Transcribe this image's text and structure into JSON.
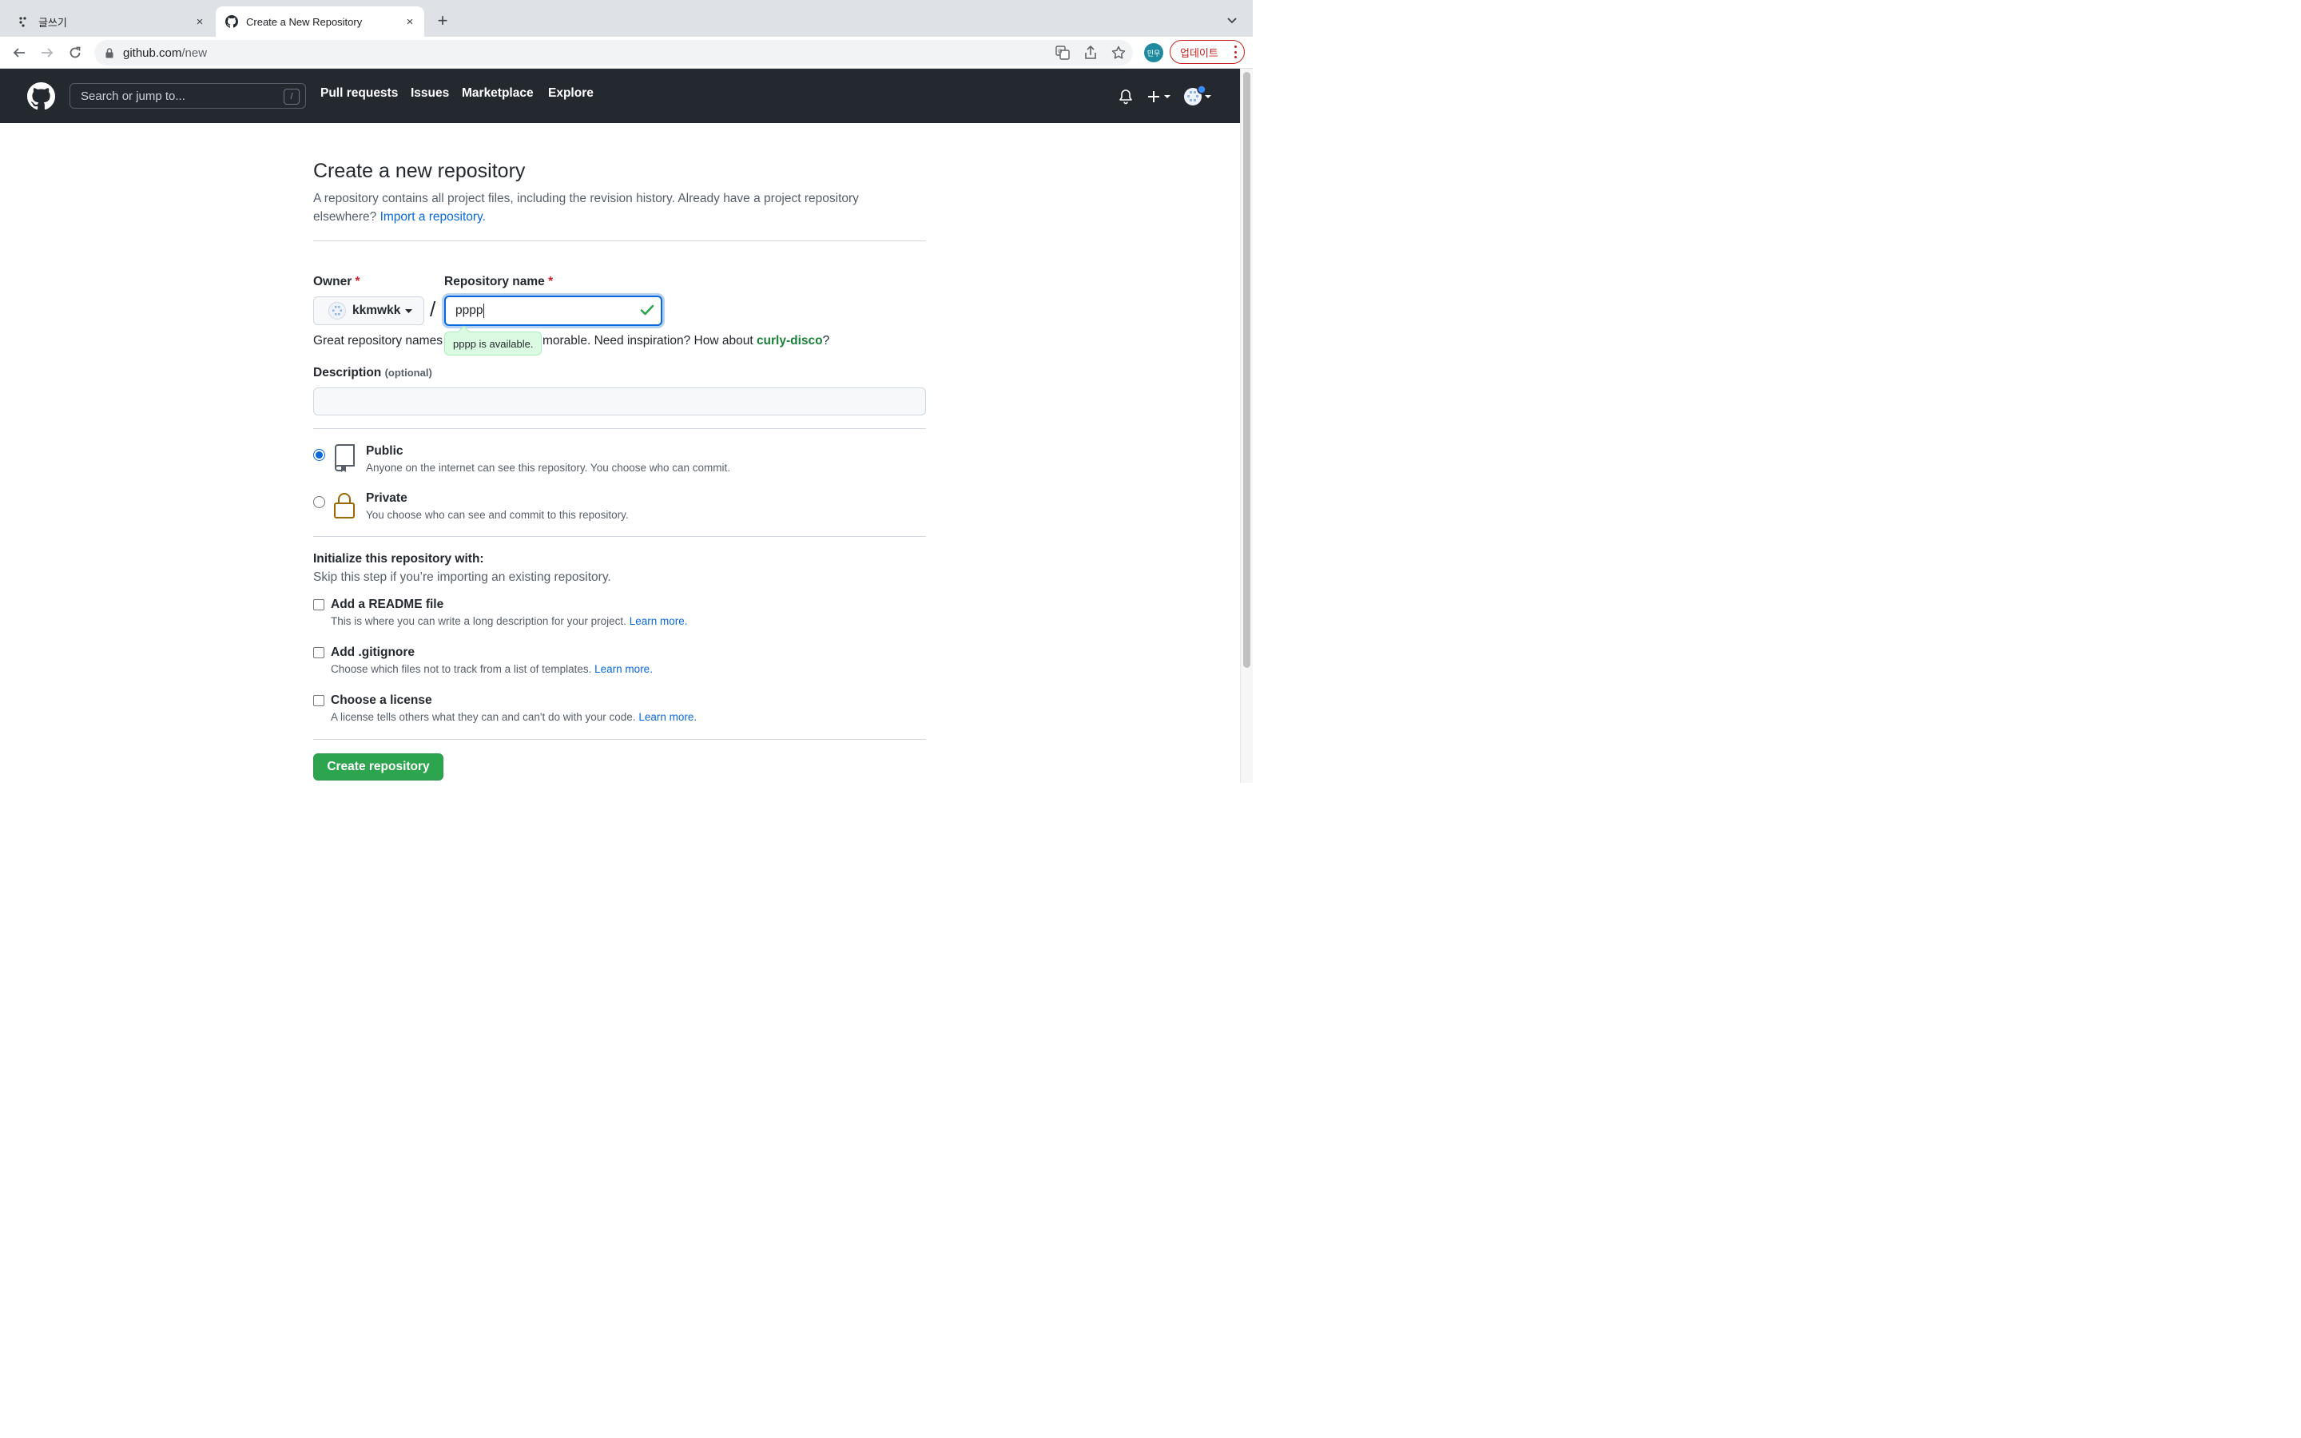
{
  "browser": {
    "tabs": [
      {
        "title": "글쓰기",
        "close": "×"
      },
      {
        "title": "Create a New Repository",
        "close": "×"
      }
    ],
    "new_tab": "+",
    "url_host": "github.com",
    "url_path": "/new",
    "profile_initials": "민우",
    "update_label": "업데이트"
  },
  "header": {
    "search_placeholder": "Search or jump to...",
    "search_shortcut": "/",
    "nav": [
      "Pull requests",
      "Issues",
      "Marketplace",
      "Explore"
    ]
  },
  "page": {
    "title": "Create a new repository",
    "lead_text": "A repository contains all project files, including the revision history. Already have a project repository elsewhere?",
    "import_link": "Import a repository."
  },
  "form": {
    "owner_label": "Owner",
    "required_mark": "*",
    "owner_value": "kkmwkk",
    "separator": "/",
    "repo_label": "Repository name",
    "repo_value": "pppp",
    "help_prefix": "Great repository names",
    "help_middle": "morable. Need inspiration? How about",
    "help_suggestion": "curly-disco",
    "help_suffix": "?",
    "availability_tooltip": "pppp is available.",
    "description_label": "Description",
    "description_optional": "(optional)",
    "description_value": ""
  },
  "visibility": [
    {
      "title": "Public",
      "desc": "Anyone on the internet can see this repository. You choose who can commit.",
      "checked": true
    },
    {
      "title": "Private",
      "desc": "You choose who can see and commit to this repository.",
      "checked": false
    }
  ],
  "initialize": {
    "title": "Initialize this repository with:",
    "subtitle": "Skip this step if you’re importing an existing repository.",
    "options": [
      {
        "title": "Add a README file",
        "desc": "This is where you can write a long description for your project.",
        "link": "Learn more."
      },
      {
        "title": "Add .gitignore",
        "desc": "Choose which files not to track from a list of templates.",
        "link": "Learn more."
      },
      {
        "title": "Choose a license",
        "desc": "A license tells others what they can and can't do with your code.",
        "link": "Learn more."
      }
    ]
  },
  "submit_label": "Create repository",
  "colors": {
    "header_bg": "#24292f",
    "primary_button": "#2da44e",
    "link": "#0969da",
    "success_text": "#1a7f37",
    "required": "#cf222e",
    "update_button": "#c5221f"
  }
}
